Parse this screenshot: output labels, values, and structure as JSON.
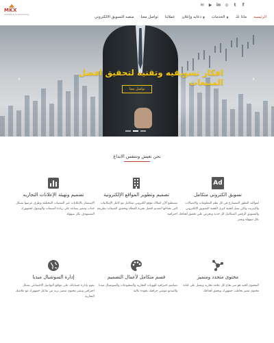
{
  "brand": {
    "logo_text": "MKX",
    "tagline": "marketing & advertising"
  },
  "social": {
    "icons": [
      "facebook-icon",
      "twitter-icon",
      "instagram-icon",
      "linkedin-icon",
      "youtube-icon",
      "email-icon"
    ],
    "glyphs": [
      "f",
      "t",
      "◎",
      "in",
      "▶",
      "✉"
    ]
  },
  "nav": {
    "items": [
      {
        "label": "الرئيسيه",
        "active": true
      },
      {
        "label": "ماذا نك",
        "dropdown": false
      },
      {
        "label": "الخدمات",
        "dropdown": true
      },
      {
        "label": "دعايه وإعلان",
        "dropdown": true
      },
      {
        "label": "عملائنا"
      },
      {
        "label": "تواصل معنا"
      },
      {
        "label": "منصه التسويق الالكتروني"
      }
    ]
  },
  "hero": {
    "title": "افكار تسويقيه وتقنيه لتحقيق افضل المبيعات",
    "button_label": "تواصل معنا",
    "prev": "‹",
    "next": "›",
    "slides": 3,
    "active_slide": 2
  },
  "section": {
    "title": "نحن نعيش ونتنفس الابداع"
  },
  "features": [
    {
      "icon": "ad-icon",
      "icon_text": "Ad",
      "title": "تسويق الكتروني متكامل",
      "desc": "لمواكبه التطور المتسارع في كل نظم المعلومات والاتصالات والإنترنت ولكن يمثل أهمية كبرى لأهمية التسويق الإلكتروني والتسويق الرقمي المتكامل كل جديد ونحرص علي تحقيق أهدافك بكل سهولة ويسر"
    },
    {
      "icon": "building-icon",
      "title": "تصميم وتطوير المواقع الإلكترونية",
      "desc": "تستطيع الآن امتلاك موقع الكتروني متكامل مع كامل الإمكانيات التي تحتاجها لتقديم افضل تجربة للعملاء وتحقيق المبيعات بطريقة احترافية"
    },
    {
      "icon": "chart-icon",
      "title": "تصميم وتهيئة الإعلانات التجاريه",
      "desc": "الاستثمار بالإعلانات عبر المنصات المختلفة وطرق عرضها بشكل جذاب ومميز يساعد على زيادة المبيعات والوصول لجمهورك المستهدف بكل سهولة"
    },
    {
      "icon": "hub-icon",
      "title": "محتوى متجدد ومتميز",
      "desc": "المحتوى الجيد هو سر نجاح كل علامه تجاريه ونعمل على كتابة محتوى مميز يخاطب جمهورك ويحقق أهدافك"
    },
    {
      "icon": "palette-icon",
      "title": "قسم متكامل لأعمال التصميم",
      "desc": "تصاميم احترافيه للهويات التجاريه والمطبوعات والسوشيال ميديا والفيديو موشن جرافيك بجودة عالية"
    },
    {
      "icon": "globe-icon",
      "title": "إدارة السوشيال ميديا",
      "desc": "نقوم بإدارة حساباتك على مواقع التواصل الاجتماعي بشكل احترافي ونشر محتوى متميز يزيد من تفاعل جمهورك مع علامتك التجارية"
    }
  ]
}
